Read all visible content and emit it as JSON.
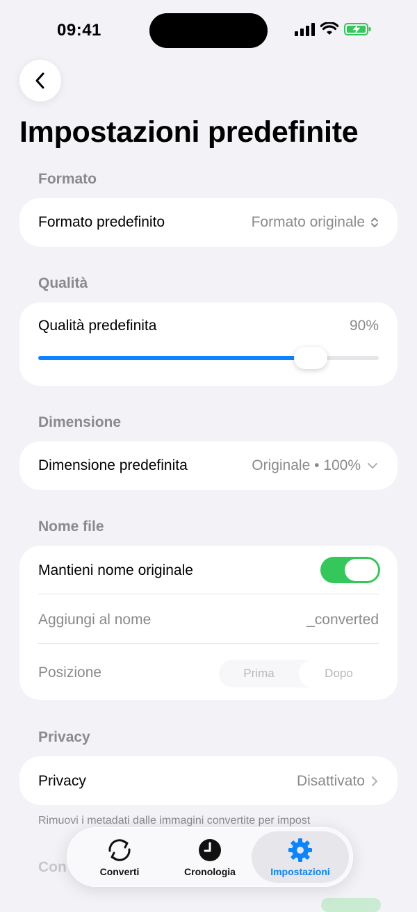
{
  "status_bar": {
    "time": "09:41"
  },
  "nav": {
    "title": "Impostazioni predefinite"
  },
  "sections": {
    "format": {
      "header": "Formato",
      "label": "Formato predefinito",
      "value": "Formato originale"
    },
    "quality": {
      "header": "Qualità",
      "label": "Qualità predefinita",
      "value": "90%",
      "slider_level": 0.8
    },
    "size": {
      "header": "Dimensione",
      "label": "Dimensione predefinita",
      "value": "Originale • 100%"
    },
    "filename": {
      "header": "Nome file",
      "keep_label": "Mantieni nome originale",
      "keep_on": true,
      "append_label": "Aggiungi al nome",
      "append_value": "_converted",
      "position_label": "Posizione",
      "position_options": [
        "Prima",
        "Dopo"
      ],
      "position_selected": "Dopo"
    },
    "privacy": {
      "header": "Privacy",
      "label": "Privacy",
      "value": "Disattivato",
      "footnote": "Rimuovi i metadati dalle immagini convertite per impost"
    },
    "next_header": "Con"
  },
  "tabbar": {
    "tabs": [
      {
        "label": "Converti",
        "icon": "convert-arrows-icon"
      },
      {
        "label": "Cronologia",
        "icon": "clock-icon"
      },
      {
        "label": "Impostazioni",
        "icon": "gear-icon",
        "active": true
      }
    ]
  },
  "colors": {
    "accent": "#0a84ff",
    "toggle_on": "#34c759",
    "background": "#f2f2f7",
    "secondary_text": "#8a8a8e"
  }
}
